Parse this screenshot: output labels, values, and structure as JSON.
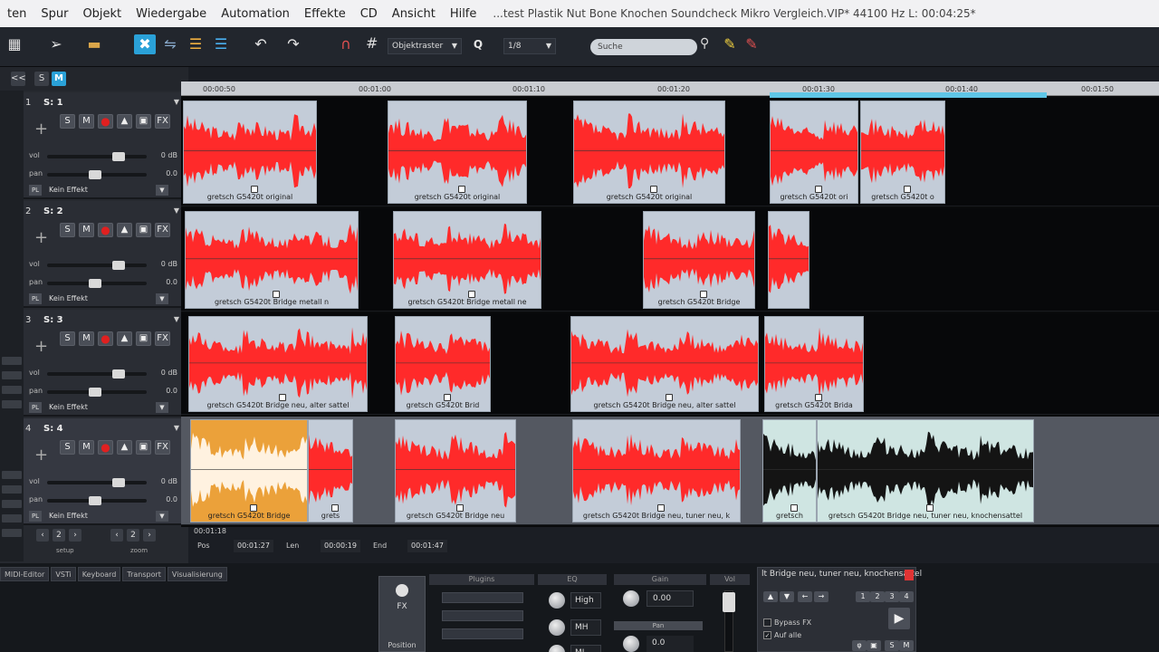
{
  "menubar": {
    "items": [
      "ten",
      "Spur",
      "Objekt",
      "Wiedergabe",
      "Automation",
      "Effekte",
      "CD",
      "Ansicht",
      "Hilfe"
    ],
    "title": "...test Plastik Nut Bone Knochen Soundcheck Mikro Vergleich.VIP*   44100 Hz L: 00:04:25*"
  },
  "toolbar": {
    "grid_mode": "Objektraster",
    "q_label": "Q",
    "quantize": "1/8",
    "search_placeholder": "Suche",
    "icons": [
      "undo-icon",
      "redo-icon",
      "magnet-icon",
      "grid-icon",
      "search-icon",
      "pencil-icon",
      "eraser-icon"
    ]
  },
  "panel": {
    "s_label": "S",
    "m_label": "M",
    "collapse": "<<",
    "setup_label": "setup",
    "zoom_label": "zoom",
    "setup_values": [
      "2"
    ],
    "zoom_values": [
      "2"
    ]
  },
  "tracks": [
    {
      "num": "1",
      "name": "S: 1",
      "vol_label": "vol",
      "vol_val": "0 dB",
      "pan_label": "pan",
      "pan_val": "0.0",
      "pl": "PL",
      "fx": "Kein Effekt"
    },
    {
      "num": "2",
      "name": "S: 2",
      "vol_label": "vol",
      "vol_val": "0 dB",
      "pan_label": "pan",
      "pan_val": "0.0",
      "pl": "PL",
      "fx": "Kein Effekt"
    },
    {
      "num": "3",
      "name": "S: 3",
      "vol_label": "vol",
      "vol_val": "0 dB",
      "pan_label": "pan",
      "pan_val": "0.0",
      "pl": "PL",
      "fx": "Kein Effekt"
    },
    {
      "num": "4",
      "name": "S: 4",
      "vol_label": "vol",
      "vol_val": "0 dB",
      "pan_label": "pan",
      "pan_val": "0.0",
      "pl": "PL",
      "fx": "Kein Effekt"
    }
  ],
  "track_buttons": {
    "s": "S",
    "m": "M",
    "fx": "FX"
  },
  "ruler": {
    "ticks": [
      "00:00:50",
      "00:01:00",
      "00:01:10",
      "00:01:20",
      "00:01:30",
      "00:01:40",
      "00:01:50"
    ]
  },
  "clips": [
    {
      "lane": 0,
      "label": "gretsch G5420t original",
      "color": "red"
    },
    {
      "lane": 0,
      "label": "gretsch G5420t original",
      "color": "red"
    },
    {
      "lane": 0,
      "label": "gretsch G5420t original",
      "color": "red"
    },
    {
      "lane": 0,
      "label": "gretsch G5420t ori",
      "color": "red"
    },
    {
      "lane": 0,
      "label": "gretsch G5420t o",
      "color": "red"
    },
    {
      "lane": 1,
      "label": "gretsch G5420t Bridge metall n",
      "color": "red"
    },
    {
      "lane": 1,
      "label": "gretsch G5420t Bridge metall ne",
      "color": "red"
    },
    {
      "lane": 1,
      "label": "gretsch G5420t Bridge",
      "color": "red"
    },
    {
      "lane": 1,
      "label": "",
      "color": "red"
    },
    {
      "lane": 2,
      "label": "gretsch G5420t Bridge neu, alter sattel",
      "color": "red"
    },
    {
      "lane": 2,
      "label": "gretsch G5420t Brid",
      "color": "red"
    },
    {
      "lane": 2,
      "label": "gretsch G5420t Bridge neu, alter sattel",
      "color": "red"
    },
    {
      "lane": 2,
      "label": "gretsch G5420t Brida",
      "color": "red"
    },
    {
      "lane": 3,
      "label": "gretsch G5420t Bridge",
      "color": "orange"
    },
    {
      "lane": 3,
      "label": "grets",
      "color": "red"
    },
    {
      "lane": 3,
      "label": "gretsch G5420t Bridge neu",
      "color": "red"
    },
    {
      "lane": 3,
      "label": "gretsch G5420t Bridge neu, tuner neu, k",
      "color": "red"
    },
    {
      "lane": 3,
      "label": "gretsch",
      "color": "black"
    },
    {
      "lane": 3,
      "label": "gretsch G5420t Bridge neu, tuner neu, knochensattel",
      "color": "black"
    }
  ],
  "position": {
    "cursor": "00:01:18",
    "pos_label": "Pos",
    "pos_val": "00:01:27",
    "len_label": "Len",
    "len_val": "00:00:19",
    "end_label": "End",
    "end_val": "00:01:47"
  },
  "bottom_tabs": [
    "MIDI-Editor",
    "VSTi",
    "Keyboard",
    "Transport",
    "Visualisierung"
  ],
  "mixer": {
    "fx_label": "FX",
    "position_label": "Position",
    "plugins_head": "Plugins",
    "eq_head": "EQ",
    "gain_head": "Gain",
    "vol_head": "Vol",
    "eq_bands": [
      "High",
      "MH",
      "ML"
    ],
    "gain_val": "0.00",
    "pan_head": "Pan",
    "pan_val": "0.0"
  },
  "channel": {
    "title": "lt Bridge neu, tuner neu, knochensattel",
    "numbers": [
      "1",
      "2",
      "3",
      "4"
    ],
    "bypass": "Bypass FX",
    "auf_alle": "Auf alle",
    "s": "S",
    "m": "M"
  },
  "colors": {
    "accent": "#2aa1d8",
    "wave_red": "#ff2a2a",
    "clip_bg": "#c3ccd8",
    "orange": "#eba13a",
    "loop": "#5fc6e6"
  }
}
